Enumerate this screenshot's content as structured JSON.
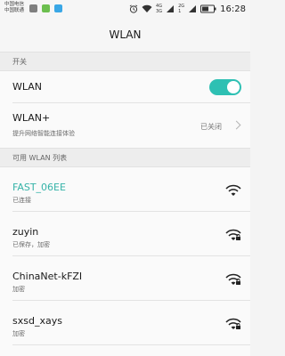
{
  "status_bar": {
    "carrier_1": "中国电信",
    "carrier_2": "中国联通",
    "network_4g_top": "4G",
    "network_4g_bottom": "3G",
    "network_2g_top": "2G",
    "network_2g_bottom": "1",
    "time": "16:28"
  },
  "header": {
    "title": "WLAN"
  },
  "switch_section": {
    "header": "开关",
    "wlan_label": "WLAN",
    "wlan_enabled": true,
    "wlan_plus_label": "WLAN+",
    "wlan_plus_desc": "提升网络智能连接体验",
    "wlan_plus_state": "已关闭"
  },
  "networks_section": {
    "header": "可用 WLAN 列表",
    "items": [
      {
        "ssid": "FAST_06EE",
        "status": "已连接",
        "connected": true,
        "locked": false
      },
      {
        "ssid": "zuyin",
        "status": "已保存，加密",
        "connected": false,
        "locked": true
      },
      {
        "ssid": "ChinaNet-kFZI",
        "status": "加密",
        "connected": false,
        "locked": true
      },
      {
        "ssid": "sxsd_xays",
        "status": "加密",
        "connected": false,
        "locked": true
      }
    ]
  },
  "colors": {
    "accent": "#2ec0b3",
    "connected_text": "#35b3a8"
  },
  "icons": [
    "wifi-status-icon",
    "alarm-icon",
    "battery-icon",
    "wifi-signal-icon",
    "chevron-right-icon",
    "lock-icon"
  ]
}
